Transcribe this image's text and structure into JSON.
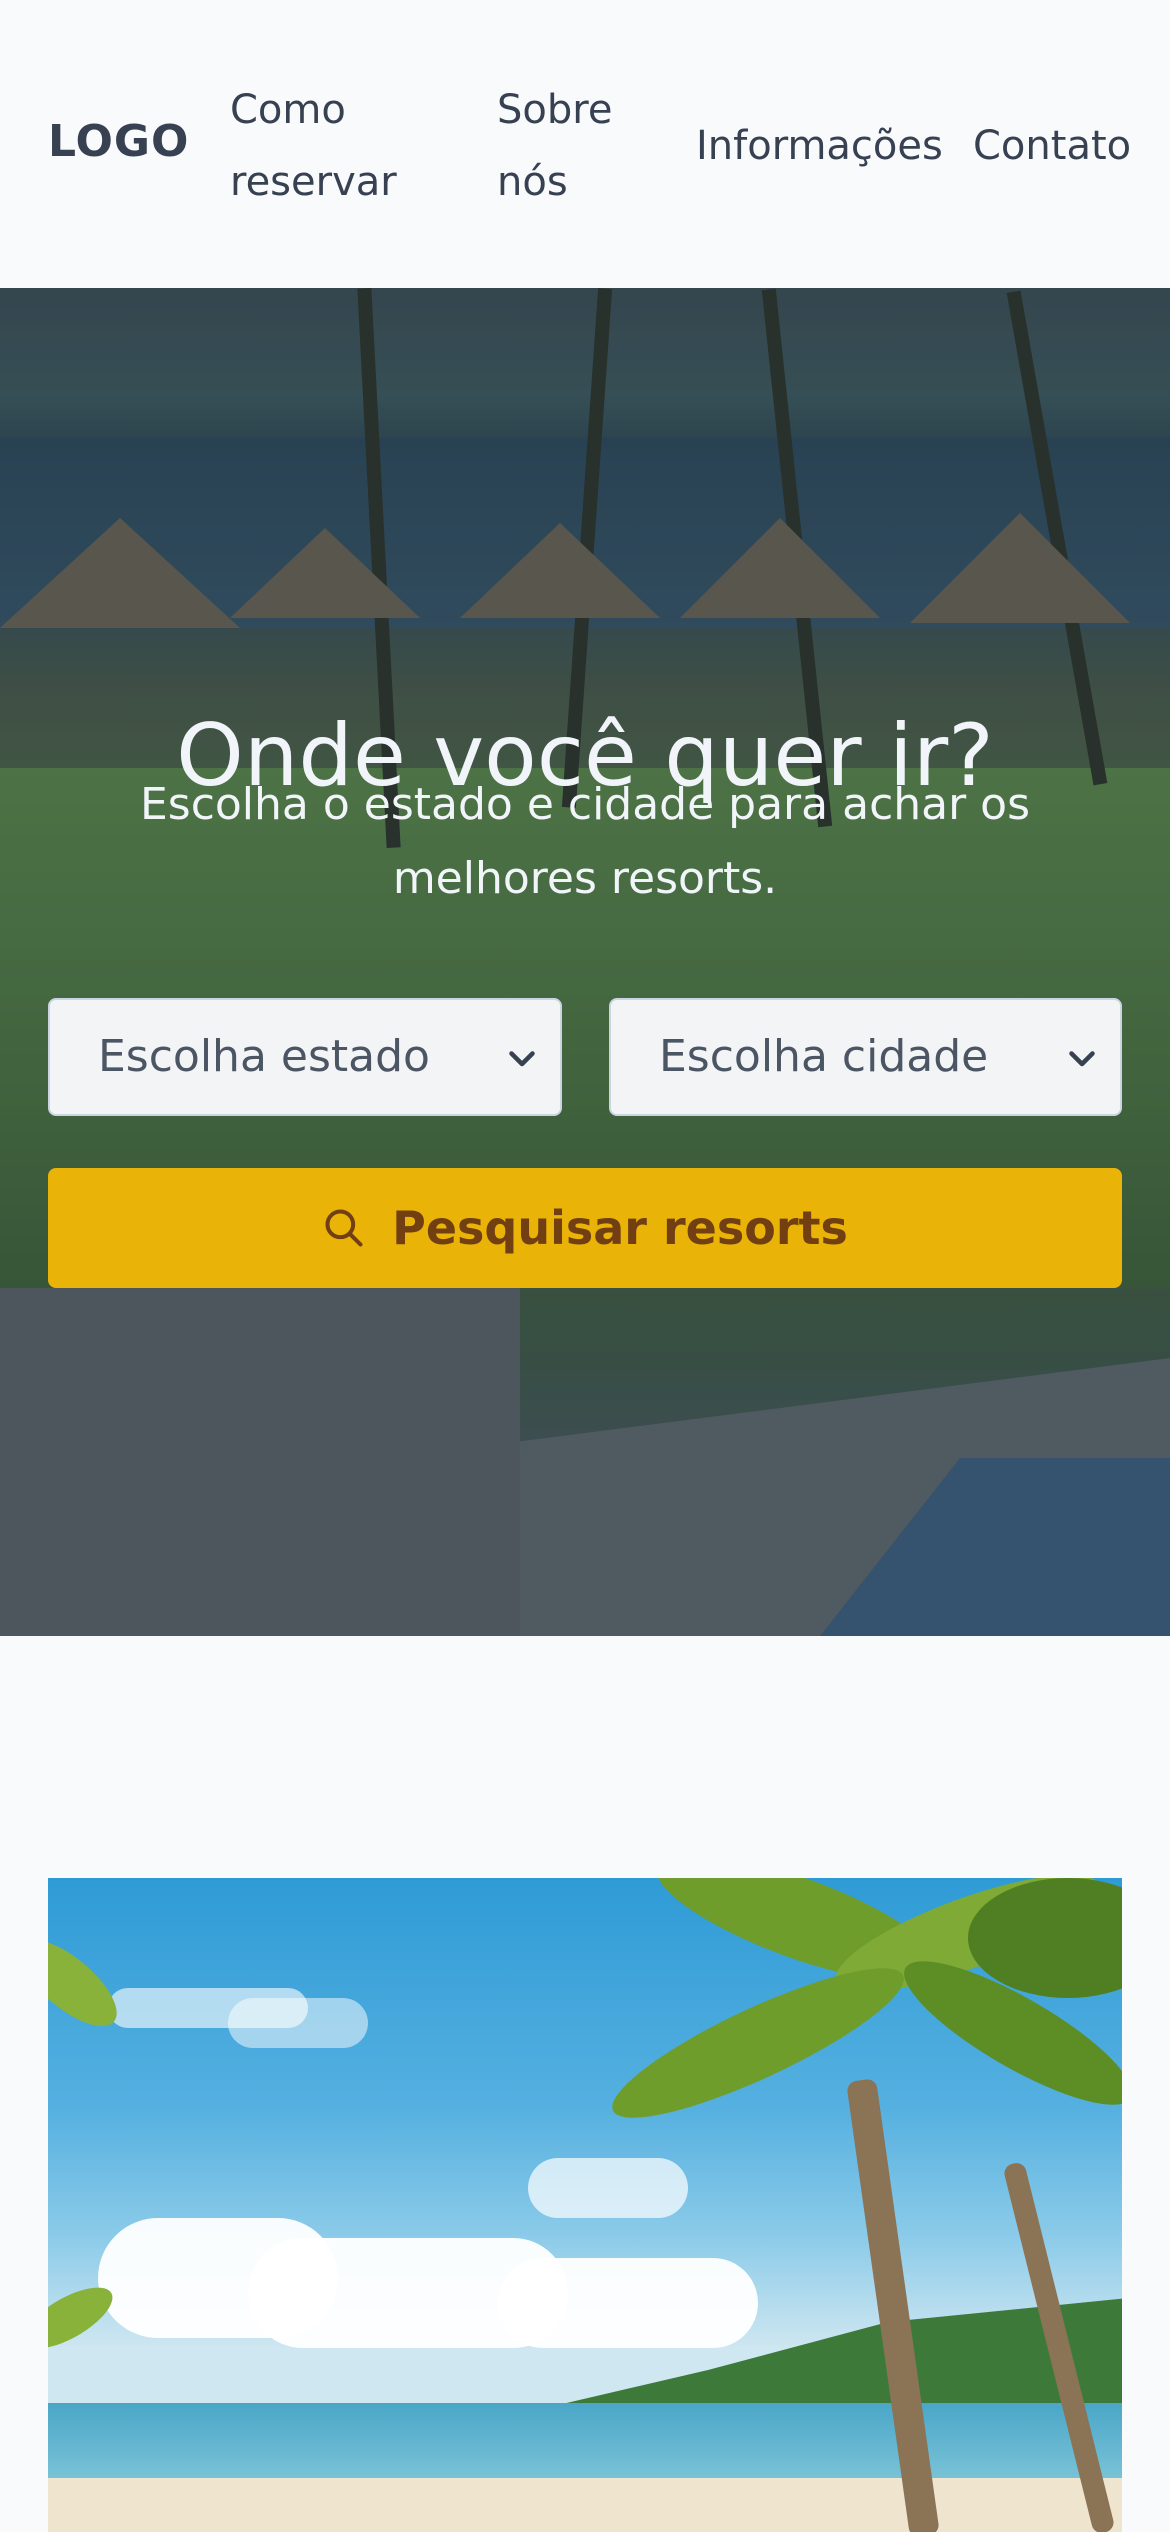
{
  "header": {
    "logo": "LOGO",
    "nav": [
      {
        "label": "Como reservar"
      },
      {
        "label": "Sobre nós"
      },
      {
        "label": "Informações"
      },
      {
        "label": "Contato"
      }
    ]
  },
  "hero": {
    "title": "Onde você quer ir?",
    "subtitle": "Escolha o estado e cidade para achar os melhores resorts.",
    "state_select": {
      "value": "Escolha estado",
      "icon": "chevron-down-icon"
    },
    "city_select": {
      "value": "Escolha cidade",
      "icon": "chevron-down-icon"
    },
    "search_button": {
      "label": "Pesquisar resorts",
      "icon": "search-icon"
    }
  },
  "colors": {
    "accent": "#eab308",
    "accent_text": "#713f12",
    "background": "#f8fafc",
    "text": "#374151"
  }
}
